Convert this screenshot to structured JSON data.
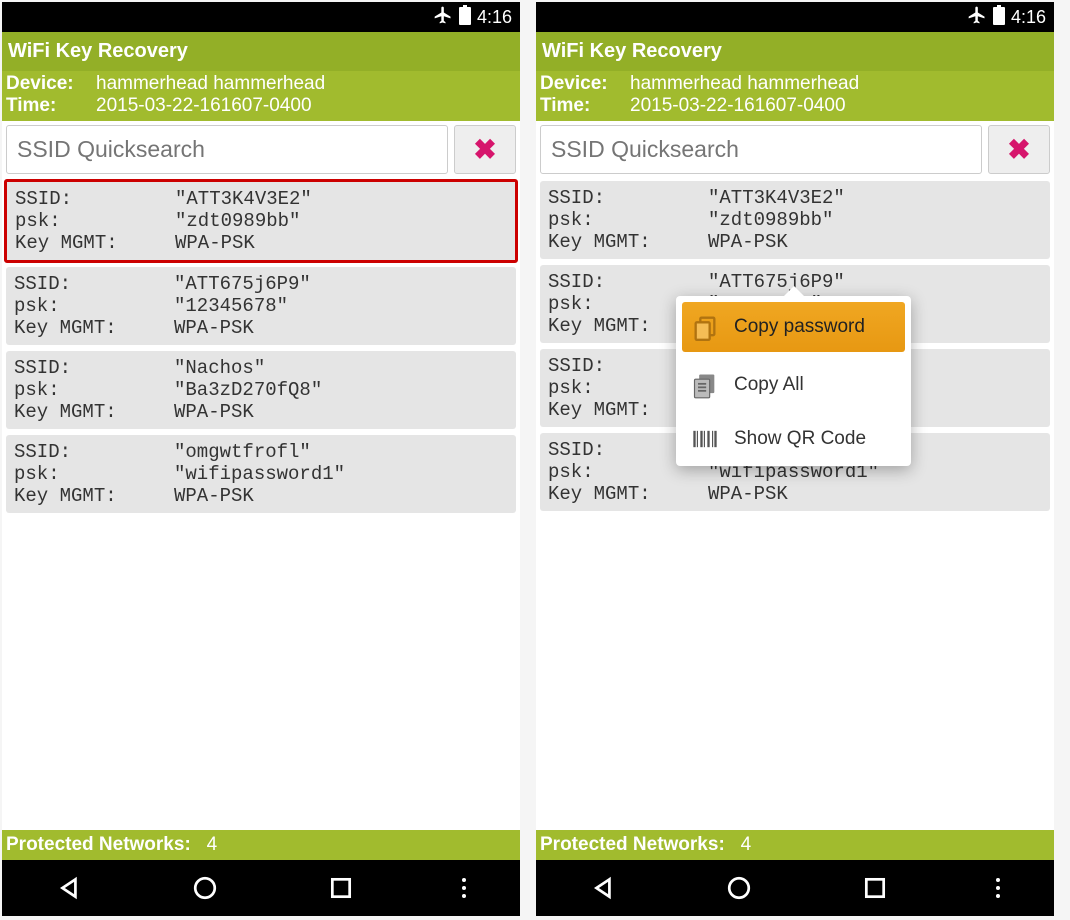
{
  "status": {
    "time": "4:16"
  },
  "app": {
    "title": "WiFi Key Recovery"
  },
  "info": {
    "device_label": "Device:",
    "device_value": "hammerhead hammerhead",
    "time_label": "Time:",
    "time_value": "2015-03-22-161607-0400"
  },
  "search": {
    "placeholder": "SSID Quicksearch"
  },
  "labels": {
    "ssid": "SSID:",
    "psk": "psk:",
    "keymgmt": "Key MGMT:"
  },
  "networks": [
    {
      "ssid": "\"ATT3K4V3E2\"",
      "psk": "\"zdt0989bb\"",
      "keymgmt": "WPA-PSK"
    },
    {
      "ssid": "\"ATT675j6P9\"",
      "psk": "\"12345678\"",
      "keymgmt": "WPA-PSK"
    },
    {
      "ssid": "\"Nachos\"",
      "psk": "\"Ba3zD270fQ8\"",
      "keymgmt": "WPA-PSK"
    },
    {
      "ssid": "\"omgwtfrofl\"",
      "psk": "\"wifipassword1\"",
      "keymgmt": "WPA-PSK"
    }
  ],
  "popup": {
    "copy_password": "Copy password",
    "copy_all": "Copy All",
    "show_qr": "Show QR Code"
  },
  "footer": {
    "label": "Protected Networks:",
    "count": "4"
  }
}
